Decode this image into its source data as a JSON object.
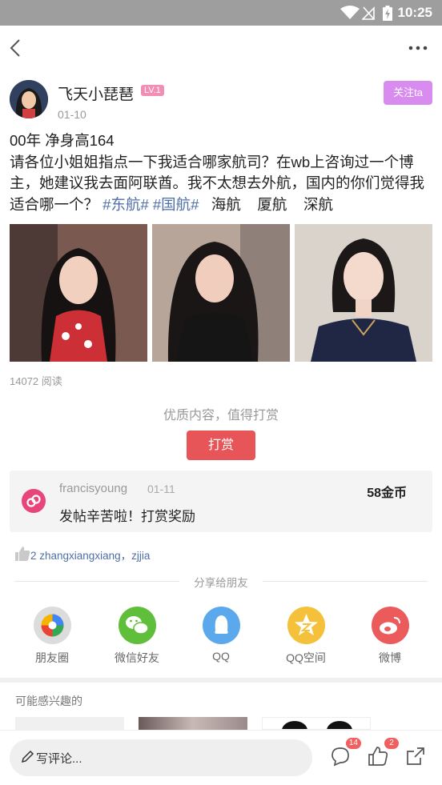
{
  "status_bar": {
    "time": "10:25"
  },
  "author": {
    "name": "飞天小琵琶",
    "level": "LV.1",
    "date": "01-10",
    "follow_label": "关注ta"
  },
  "post": {
    "line1": "00年 净身高164",
    "body": "请各位小姐姐指点一下我适合哪家航司？在wb上咨询过一个博主，她建议我去面阿联酋。我不太想去外航，国内的你们觉得我适合哪一个？",
    "tag1": "#东航#",
    "tag2": "#国航#",
    "tail": "  海航    厦航    深航"
  },
  "read_count": "14072 阅读",
  "reward": {
    "prompt": "优质内容，值得打赏",
    "button_label": "打赏",
    "record": {
      "user": "francisyoung",
      "date": "01-11",
      "coins": "58金币",
      "message": "发帖辛苦啦！打赏奖励"
    }
  },
  "likes": {
    "names": "2 zhangxiangxiang，zjjia"
  },
  "share": {
    "title": "分享给朋友",
    "targets": [
      {
        "label": "朋友圈",
        "icon": "moments-icon",
        "color": "#dcdcdc"
      },
      {
        "label": "微信好友",
        "icon": "wechat-icon",
        "color": "#5fbe3a"
      },
      {
        "label": "QQ",
        "icon": "qq-icon",
        "color": "#5ba9ec"
      },
      {
        "label": "QQ空间",
        "icon": "qzone-icon",
        "color": "#f5c13b"
      },
      {
        "label": "微博",
        "icon": "weibo-icon",
        "color": "#ec5b5b"
      }
    ]
  },
  "interest": {
    "title": "可能感兴趣的"
  },
  "bottom_bar": {
    "comment_placeholder": "写评论...",
    "comment_count": "14",
    "like_count": "2"
  }
}
